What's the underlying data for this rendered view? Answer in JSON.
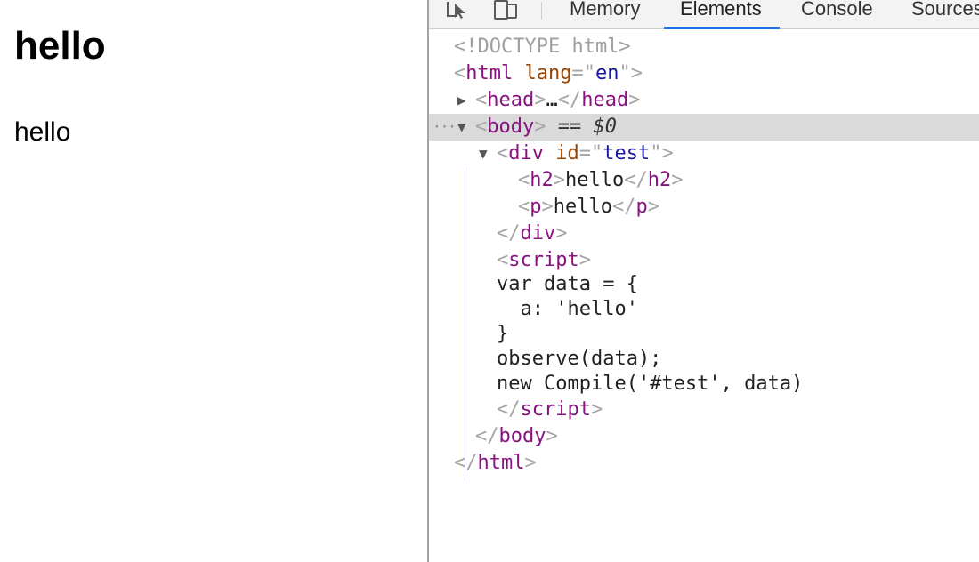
{
  "viewport": {
    "heading": "hello",
    "paragraph": "hello"
  },
  "devtools": {
    "tabs": [
      {
        "label": "Memory"
      },
      {
        "label": "Elements"
      },
      {
        "label": "Console"
      },
      {
        "label": "Sources"
      }
    ],
    "active_tab": "Elements",
    "tree": {
      "doctype": "<!DOCTYPE html>",
      "html_open_tag": "html",
      "lang_attr": "lang",
      "lang_val": "en",
      "head_tag": "head",
      "head_ellipsis": "…",
      "body_tag": "body",
      "selected_marker": "== $0",
      "div_tag": "div",
      "div_id_attr": "id",
      "div_id_val": "test",
      "h2_tag": "h2",
      "h2_text": "hello",
      "p_tag": "p",
      "p_text": "hello",
      "script_tag": "script",
      "script_line1": "var data = {",
      "script_line2": "  a: 'hello'",
      "script_line3": "}",
      "script_line4": "observe(data);",
      "script_line5": "new Compile('#test', data)"
    },
    "accent_color": "#1a73e8"
  }
}
